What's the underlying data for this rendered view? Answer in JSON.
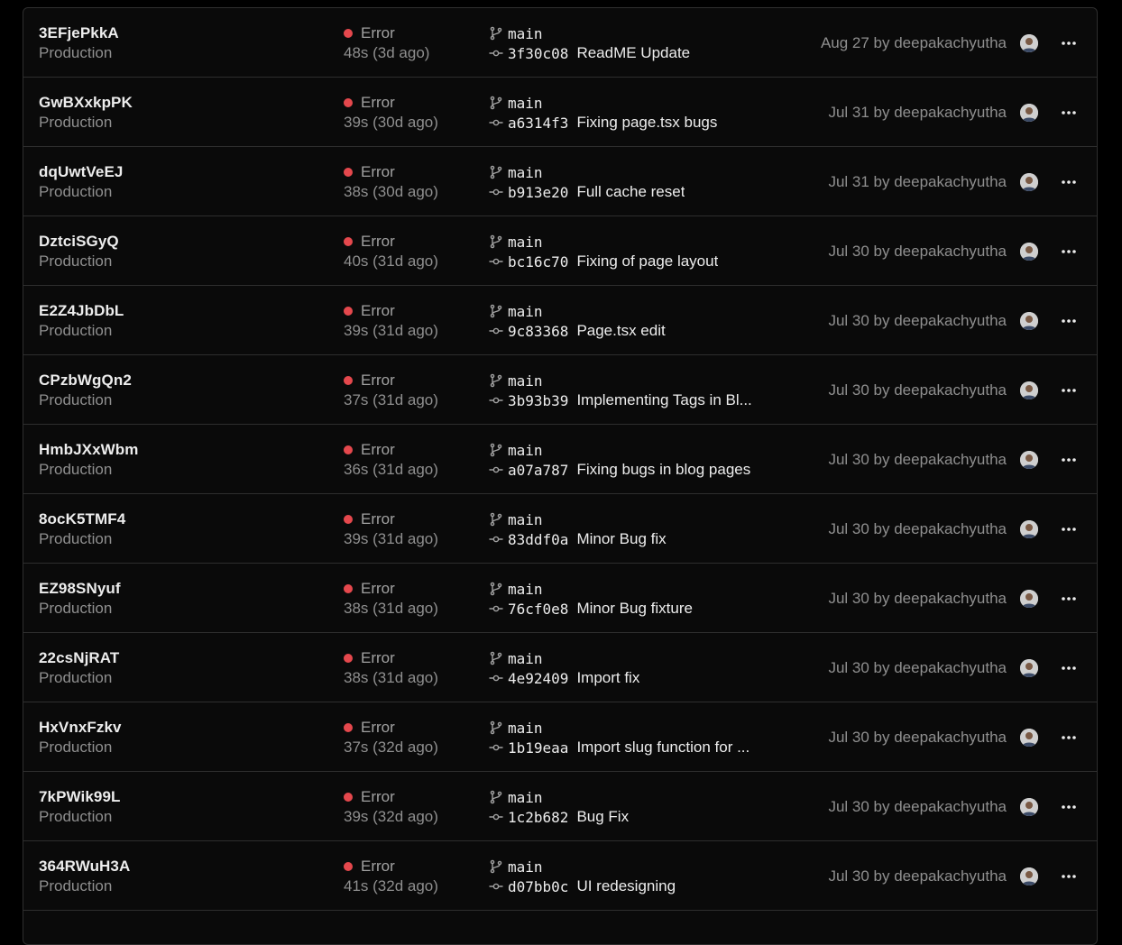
{
  "deployments": [
    {
      "id": "3EFjePkkA",
      "env": "Production",
      "status": "Error",
      "duration": "48s (3d ago)",
      "branch": "main",
      "sha": "3f30c08",
      "message": "ReadME Update",
      "meta": "Aug 27 by deepakachyutha"
    },
    {
      "id": "GwBXxkpPK",
      "env": "Production",
      "status": "Error",
      "duration": "39s (30d ago)",
      "branch": "main",
      "sha": "a6314f3",
      "message": "Fixing page.tsx bugs",
      "meta": "Jul 31 by deepakachyutha"
    },
    {
      "id": "dqUwtVeEJ",
      "env": "Production",
      "status": "Error",
      "duration": "38s (30d ago)",
      "branch": "main",
      "sha": "b913e20",
      "message": "Full cache reset",
      "meta": "Jul 31 by deepakachyutha"
    },
    {
      "id": "DztciSGyQ",
      "env": "Production",
      "status": "Error",
      "duration": "40s (31d ago)",
      "branch": "main",
      "sha": "bc16c70",
      "message": "Fixing of page layout",
      "meta": "Jul 30 by deepakachyutha"
    },
    {
      "id": "E2Z4JbDbL",
      "env": "Production",
      "status": "Error",
      "duration": "39s (31d ago)",
      "branch": "main",
      "sha": "9c83368",
      "message": "Page.tsx edit",
      "meta": "Jul 30 by deepakachyutha"
    },
    {
      "id": "CPzbWgQn2",
      "env": "Production",
      "status": "Error",
      "duration": "37s (31d ago)",
      "branch": "main",
      "sha": "3b93b39",
      "message": "Implementing Tags in Bl...",
      "meta": "Jul 30 by deepakachyutha"
    },
    {
      "id": "HmbJXxWbm",
      "env": "Production",
      "status": "Error",
      "duration": "36s (31d ago)",
      "branch": "main",
      "sha": "a07a787",
      "message": "Fixing bugs in blog pages",
      "meta": "Jul 30 by deepakachyutha"
    },
    {
      "id": "8ocK5TMF4",
      "env": "Production",
      "status": "Error",
      "duration": "39s (31d ago)",
      "branch": "main",
      "sha": "83ddf0a",
      "message": "Minor Bug fix",
      "meta": "Jul 30 by deepakachyutha"
    },
    {
      "id": "EZ98SNyuf",
      "env": "Production",
      "status": "Error",
      "duration": "38s (31d ago)",
      "branch": "main",
      "sha": "76cf0e8",
      "message": "Minor Bug fixture",
      "meta": "Jul 30 by deepakachyutha"
    },
    {
      "id": "22csNjRAT",
      "env": "Production",
      "status": "Error",
      "duration": "38s (31d ago)",
      "branch": "main",
      "sha": "4e92409",
      "message": "Import fix",
      "meta": "Jul 30 by deepakachyutha"
    },
    {
      "id": "HxVnxFzkv",
      "env": "Production",
      "status": "Error",
      "duration": "37s (32d ago)",
      "branch": "main",
      "sha": "1b19eaa",
      "message": "Import slug function for ...",
      "meta": "Jul 30 by deepakachyutha"
    },
    {
      "id": "7kPWik99L",
      "env": "Production",
      "status": "Error",
      "duration": "39s (32d ago)",
      "branch": "main",
      "sha": "1c2b682",
      "message": "Bug Fix",
      "meta": "Jul 30 by deepakachyutha"
    },
    {
      "id": "364RWuH3A",
      "env": "Production",
      "status": "Error",
      "duration": "41s (32d ago)",
      "branch": "main",
      "sha": "d07bb0c",
      "message": "UI redesigning",
      "meta": "Jul 30 by deepakachyutha"
    }
  ],
  "colors": {
    "background": "#000000",
    "panel": "#0a0a0a",
    "border": "#2e2e2e",
    "text_primary": "#ededed",
    "text_secondary": "#8f8f8f",
    "error": "#e5484d"
  },
  "icons": {
    "status": "error-dot-icon",
    "branch": "git-branch-icon",
    "commit": "git-commit-icon",
    "avatar": "user-avatar-icon",
    "menu": "more-horizontal-icon"
  }
}
